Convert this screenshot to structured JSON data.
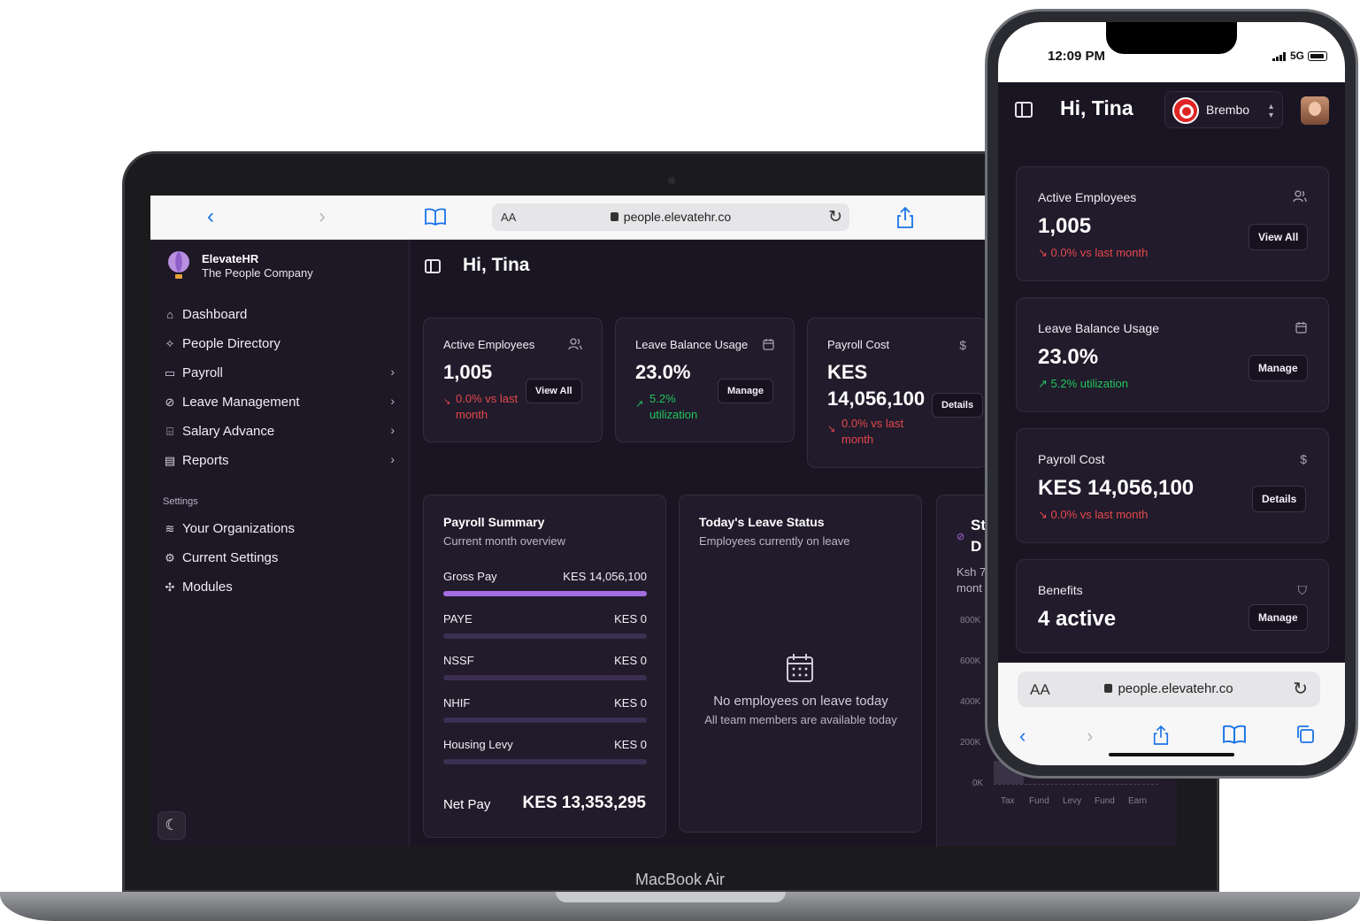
{
  "laptop": {
    "model_label": "MacBook Air",
    "browser": {
      "url": "people.elevatehr.co",
      "aa_label": "AA",
      "back_glyph": "‹",
      "forward_glyph": "›"
    },
    "brand": {
      "name": "ElevateHR",
      "tagline": "The People Company"
    },
    "nav": [
      {
        "label": "Dashboard",
        "icon": "home-icon",
        "glyph": "⌂",
        "chevron": ""
      },
      {
        "label": "People Directory",
        "icon": "person-icon",
        "glyph": "✧",
        "chevron": ""
      },
      {
        "label": "Payroll",
        "icon": "card-icon",
        "glyph": "▭",
        "chevron": "›"
      },
      {
        "label": "Leave Management",
        "icon": "calendar-off-icon",
        "glyph": "⊘",
        "chevron": "›"
      },
      {
        "label": "Salary Advance",
        "icon": "bank-icon",
        "glyph": "⌸",
        "chevron": "›"
      },
      {
        "label": "Reports",
        "icon": "clipboard-icon",
        "glyph": "▤",
        "chevron": "›"
      }
    ],
    "settings_heading": "Settings",
    "settings": [
      {
        "label": "Your Organizations",
        "icon": "layers-icon",
        "glyph": "≋"
      },
      {
        "label": "Current Settings",
        "icon": "gear-icon",
        "glyph": "⚙"
      },
      {
        "label": "Modules",
        "icon": "sparkles-icon",
        "glyph": "✣"
      }
    ],
    "theme_glyph": "☾",
    "greeting": "Hi, Tina",
    "stats": {
      "active_employees": {
        "label": "Active Employees",
        "value": "1,005",
        "trend": "0.0% vs last month",
        "trend_arrow": "↘",
        "button": "View All",
        "icon": "users-icon"
      },
      "leave_balance": {
        "label": "Leave Balance Usage",
        "value": "23.0%",
        "trend": "5.2% utilization",
        "trend_arrow": "↗",
        "button": "Manage",
        "icon": "calendar-icon"
      },
      "payroll_cost": {
        "label": "Payroll Cost",
        "value_line1": "KES",
        "value_line2": "14,056,100",
        "trend": "0.0% vs last month",
        "trend_arrow": "↘",
        "button": "Details",
        "icon": "dollar-icon",
        "icon_glyph": "$"
      }
    },
    "payroll_summary": {
      "title": "Payroll Summary",
      "subtitle": "Current month overview",
      "rows": [
        {
          "label": "Gross Pay",
          "amount": "KES 14,056,100",
          "fill": 1.0
        },
        {
          "label": "PAYE",
          "amount": "KES 0",
          "fill": 0
        },
        {
          "label": "NSSF",
          "amount": "KES 0",
          "fill": 0
        },
        {
          "label": "NHIF",
          "amount": "KES 0",
          "fill": 0
        },
        {
          "label": "Housing Levy",
          "amount": "KES 0",
          "fill": 0
        }
      ],
      "net_label": "Net Pay",
      "net_amount": "KES 13,353,295"
    },
    "leave_status": {
      "title": "Today's Leave Status",
      "subtitle": "Employees currently on leave",
      "empty_title": "No employees on leave today",
      "empty_sub": "All team members are available today"
    },
    "chart_panel": {
      "title_line1": "St",
      "title_line2": "D",
      "sub_line1": "Ksh 7",
      "sub_line2": "mont",
      "chart_data": {
        "type": "bar",
        "yticks": [
          "800K",
          "600K",
          "400K",
          "200K",
          "0K"
        ],
        "xticks": [
          "Tax",
          "Fund",
          "Levy",
          "Fund",
          "Earn"
        ]
      }
    }
  },
  "phone": {
    "status": {
      "time": "12:09 PM",
      "network": "5G"
    },
    "greeting": "Hi, Tina",
    "org": {
      "name": "Brembo",
      "chevron": "⌃⌄"
    },
    "cards": [
      {
        "label": "Active Employees",
        "value": "1,005",
        "trend": "0.0% vs last month",
        "trend_arrow": "↘",
        "trend_type": "down",
        "button": "View All",
        "icon": "users-icon",
        "glyph": "⚇"
      },
      {
        "label": "Leave Balance Usage",
        "value": "23.0%",
        "trend": "5.2% utilization",
        "trend_arrow": "↗",
        "trend_type": "up",
        "button": "Manage",
        "icon": "calendar-icon",
        "glyph": "▦"
      },
      {
        "label": "Payroll Cost",
        "value": "KES 14,056,100",
        "trend": "0.0% vs last month",
        "trend_arrow": "↘",
        "trend_type": "down",
        "button": "Details",
        "icon": "dollar-icon",
        "glyph": "$"
      },
      {
        "label": "Benefits",
        "value": "4 active",
        "trend": "",
        "trend_arrow": "",
        "trend_type": "",
        "button": "Manage",
        "icon": "gift-icon",
        "glyph": "⛉"
      }
    ],
    "browser": {
      "aa_label": "AA",
      "url": "people.elevatehr.co"
    }
  }
}
